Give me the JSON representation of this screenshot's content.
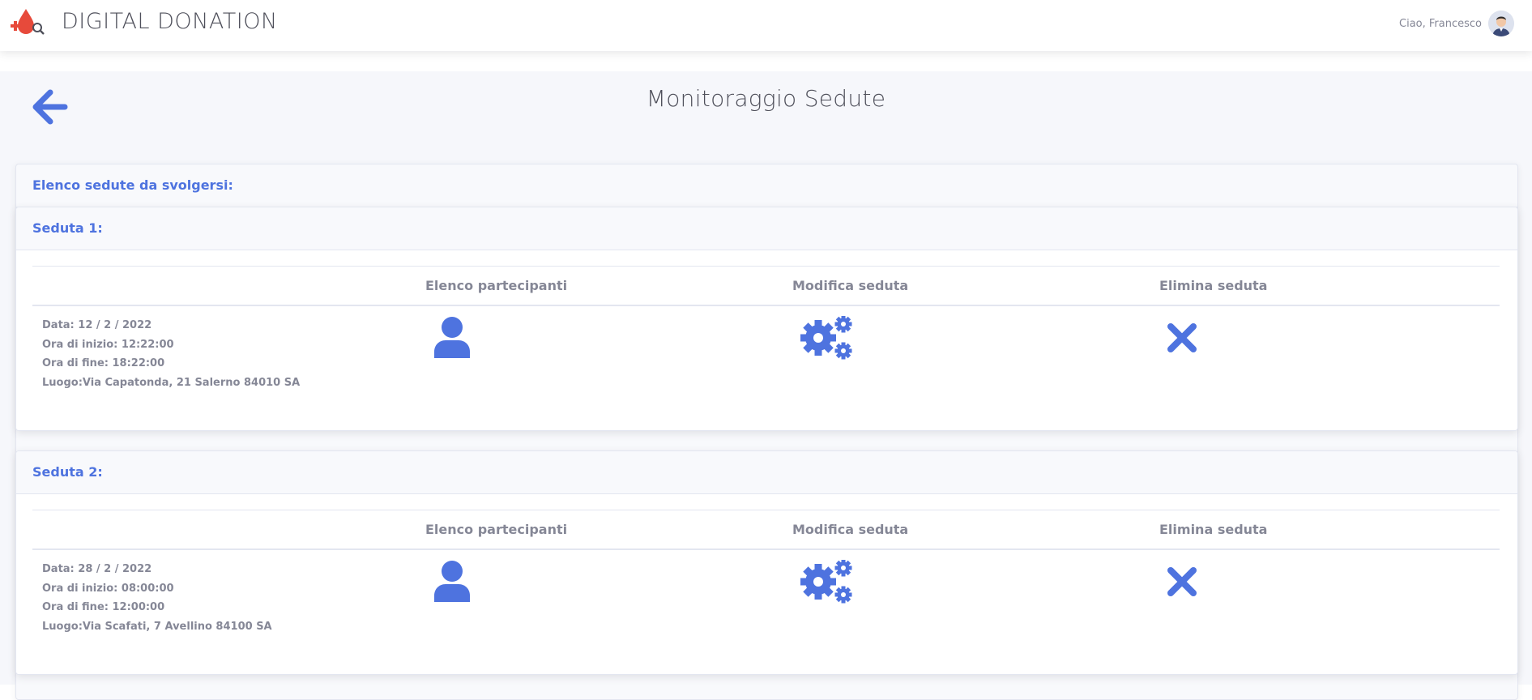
{
  "header": {
    "brand": "DIGITAL DONATION",
    "greeting": "Ciao, Francesco"
  },
  "page": {
    "title": "Monitoraggio Sedute"
  },
  "list": {
    "title": "Elenco sedute da svolgersi:",
    "columns": [
      "",
      "Elenco partecipanti",
      "Modifica seduta",
      "Elimina seduta"
    ],
    "sessions": [
      {
        "title": "Seduta 1:",
        "data": "Data: 12 / 2 / 2022",
        "inizio": "Ora di inizio: 12:22:00",
        "fine": "Ora di fine: 18:22:00",
        "luogo": "Luogo:Via Capatonda, 21 Salerno 84010 SA"
      },
      {
        "title": "Seduta 2:",
        "data": "Data: 28 / 2 / 2022",
        "inizio": "Ora di inizio: 08:00:00",
        "fine": "Ora di fine: 12:00:00",
        "luogo": "Luogo:Via Scafati, 7 Avellino 84100 SA"
      }
    ]
  },
  "icons": {
    "back": "arrow-left-icon",
    "participants": "user-icon",
    "edit": "cogs-icon",
    "delete": "times-icon"
  },
  "colors": {
    "accent": "#4e73df",
    "logo_red": "#e74a3b",
    "text_muted": "#858796",
    "background": "#f6f7fb"
  }
}
